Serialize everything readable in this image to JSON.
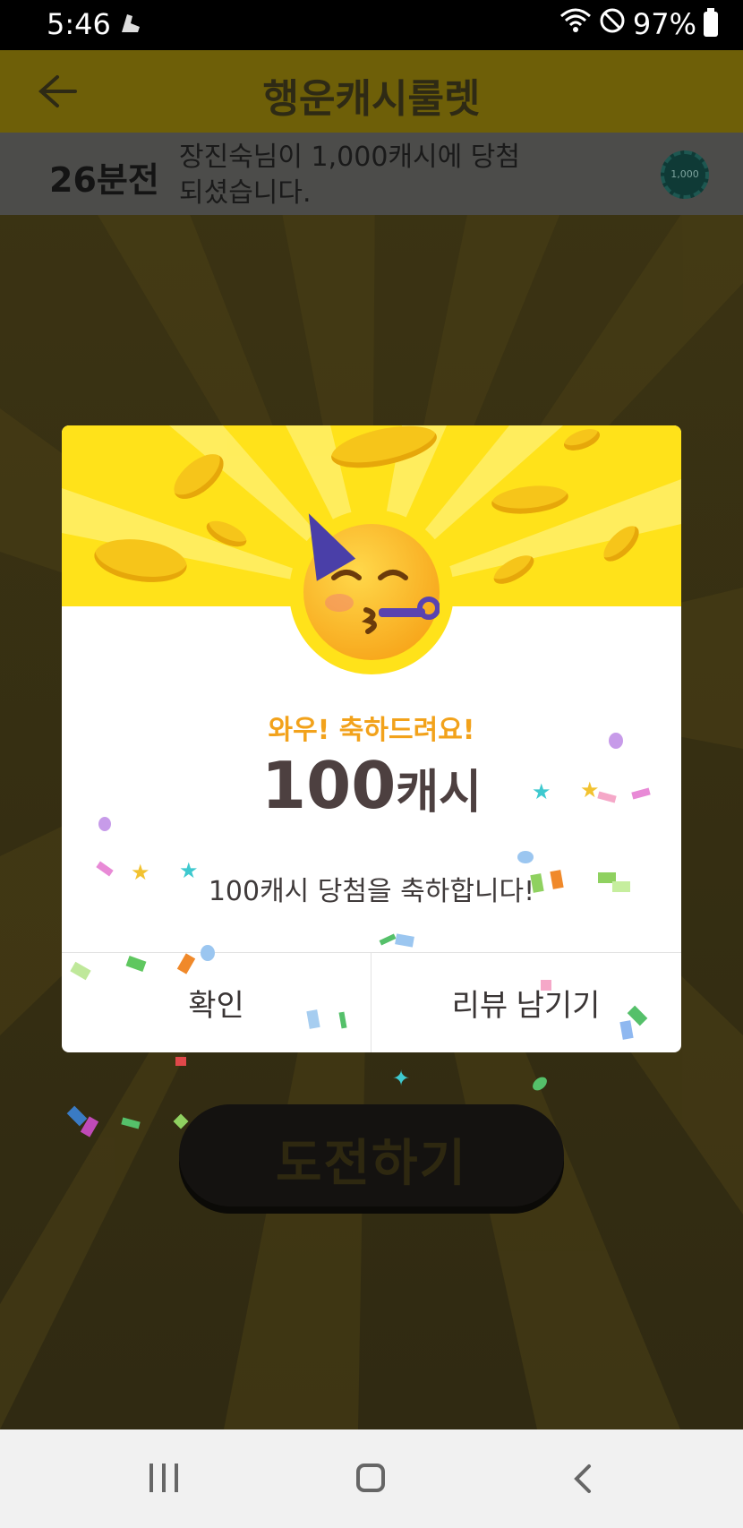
{
  "status_bar": {
    "time": "5:46",
    "battery": "97%",
    "icons": [
      "sneaker-icon",
      "wifi-icon",
      "do-not-disturb-icon",
      "battery-icon"
    ]
  },
  "header": {
    "title": "행운캐시룰렛",
    "back_icon": "arrow-left-icon"
  },
  "ticker": {
    "time_ago": "26분전",
    "message": "장진숙님이 1,000캐시에 당첨되셨습니다.",
    "badge_text": "1,000"
  },
  "dialog": {
    "congrats_text": "와우! 축하드려요!",
    "amount_number": "100",
    "amount_unit": "캐시",
    "description": "100캐시 당첨을 축하합니다!",
    "confirm_label": "확인",
    "review_label": "리뷰 남기기",
    "emoji": "partying-face-icon"
  },
  "main": {
    "challenge_label": "도전하기"
  },
  "nav": {
    "icons": [
      "recent-apps-icon",
      "home-icon",
      "back-icon"
    ]
  },
  "colors": {
    "banner_yellow": "#ffe21a",
    "congrats_orange": "#f2a21b",
    "amount_text": "#4d4040",
    "overlay_bg": "#3b3214"
  }
}
